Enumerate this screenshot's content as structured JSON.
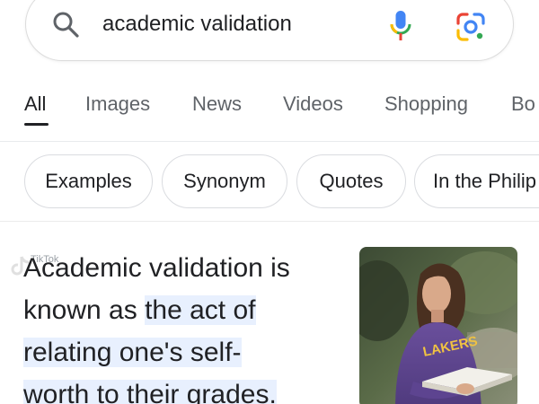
{
  "search": {
    "query": "academic validation"
  },
  "tabs": [
    {
      "label": "All",
      "active": true
    },
    {
      "label": "Images",
      "active": false
    },
    {
      "label": "News",
      "active": false
    },
    {
      "label": "Videos",
      "active": false
    },
    {
      "label": "Shopping",
      "active": false
    },
    {
      "label": "Bo",
      "active": false
    }
  ],
  "chips": [
    {
      "label": "Examples"
    },
    {
      "label": "Synonym"
    },
    {
      "label": "Quotes"
    },
    {
      "label": "In the Philip"
    }
  ],
  "snippet": {
    "line1": "Academic validation is",
    "line2_plain": "known as ",
    "line2_highlight": "the act of",
    "line3_highlight": "relating one's self-",
    "line4_highlight": "worth to their grades."
  },
  "overlay": {
    "watermark_text": "TikTok"
  },
  "image": {
    "shirt_lettering": "LAKERS"
  },
  "colors": {
    "highlight": "#e8f0fe",
    "google_blue": "#4285f4",
    "google_red": "#ea4335",
    "google_yellow": "#fbbc04",
    "google_green": "#34a853"
  }
}
